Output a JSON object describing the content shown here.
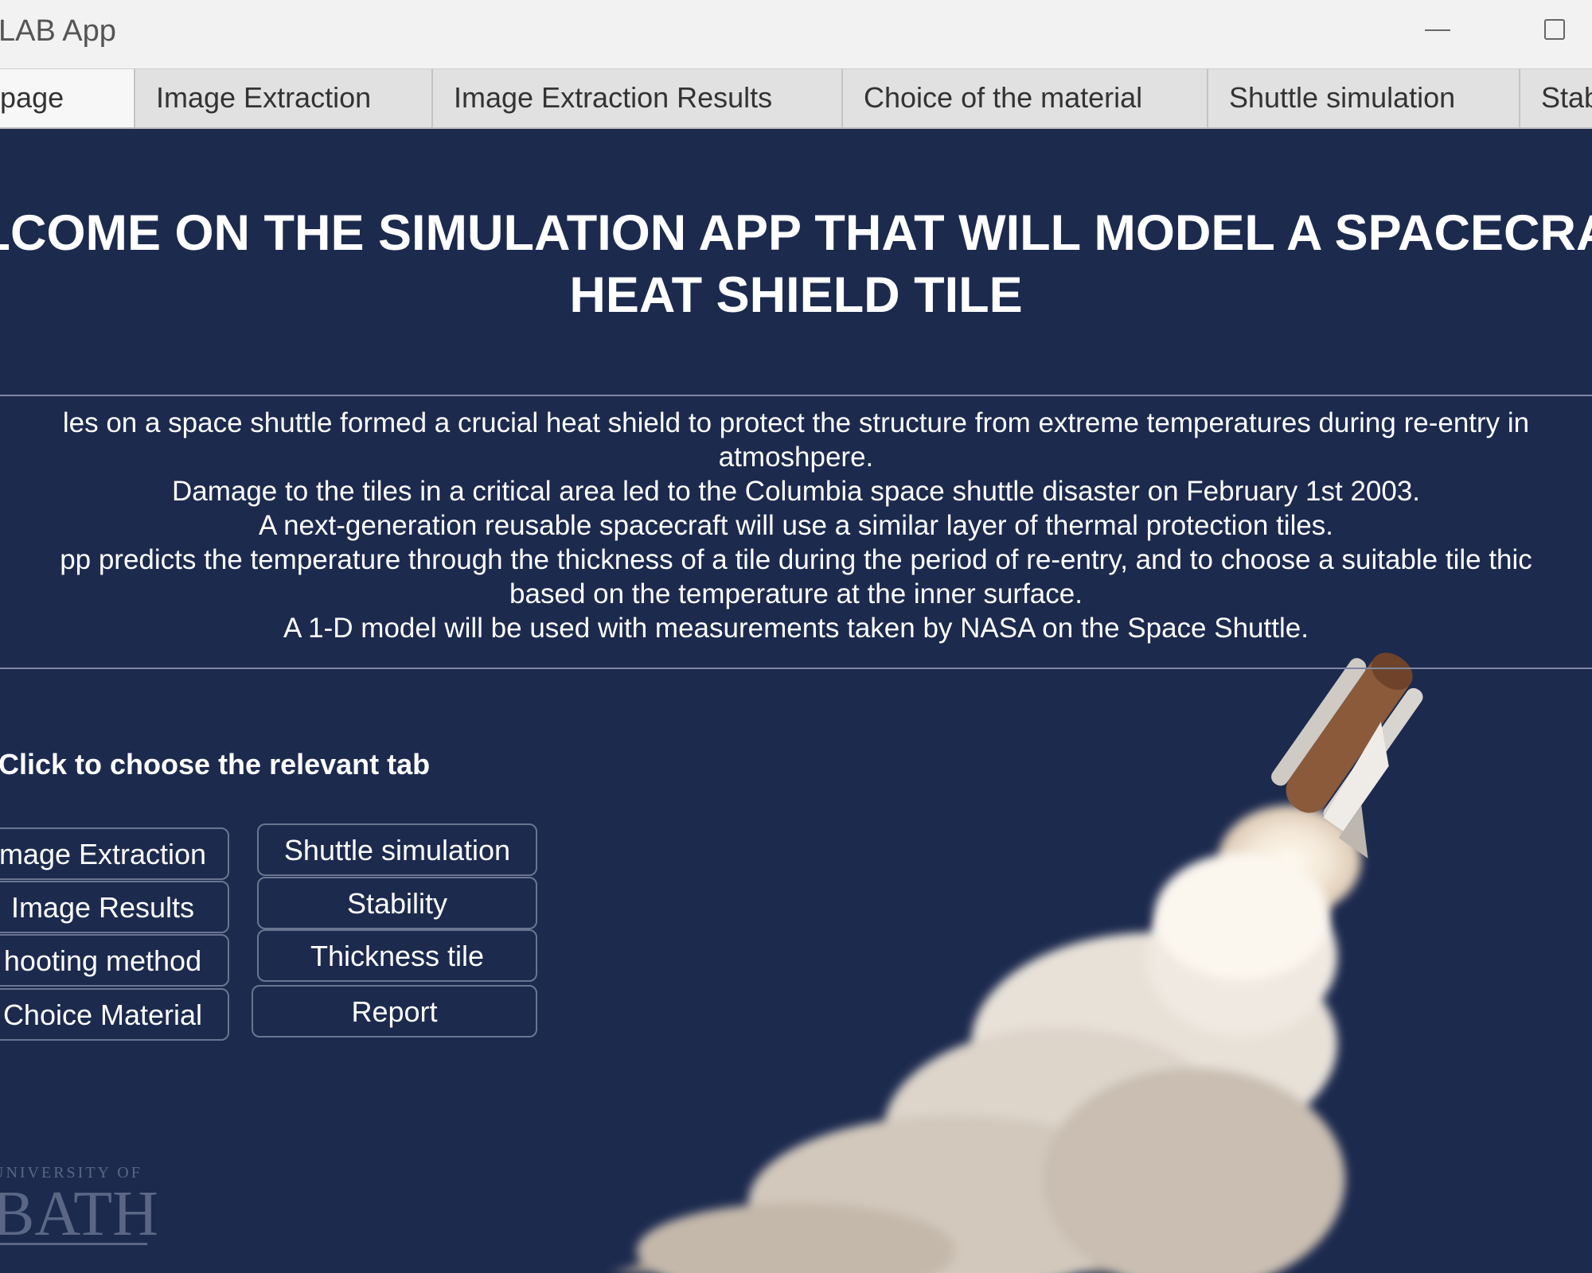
{
  "window": {
    "title": "LAB App"
  },
  "tabs": [
    {
      "label": "epage",
      "active": true
    },
    {
      "label": "Image Extraction",
      "active": false
    },
    {
      "label": "Image Extraction Results",
      "active": false
    },
    {
      "label": "Choice of the material",
      "active": false
    },
    {
      "label": "Shuttle simulation",
      "active": false
    },
    {
      "label": "Stab",
      "active": false
    }
  ],
  "main": {
    "title_line1": "LCOME ON THE SIMULATION APP THAT WILL MODEL A SPACECRA",
    "title_line2": "HEAT SHIELD TILE",
    "intro_lines": [
      "les on a space shuttle formed a crucial heat shield to protect the structure from extreme temperatures during re-entry in",
      "atmoshpere.",
      "Damage to the tiles in a critical area led to the Columbia space shuttle disaster on February 1st 2003.",
      "A next-generation reusable spacecraft will use a similar layer of thermal protection tiles.",
      "pp predicts the temperature through the thickness of a tile during the period of re-entry, and to choose a suitable tile thic",
      "based on the temperature at the inner surface.",
      "A 1-D model will be used with measurements taken by NASA on the Space Shuttle."
    ],
    "choose_label": "Click to choose the relevant tab",
    "buttons_left": [
      "mage Extraction",
      "Image Results",
      "hooting method",
      "Choice Material"
    ],
    "buttons_right": [
      "Shuttle simulation",
      "Stability",
      "Thickness tile",
      "Report"
    ]
  },
  "logo": {
    "top_text": "UNIVERSITY OF",
    "main_text": "BATH"
  },
  "colors": {
    "background": "#1c2a4e",
    "titlebar": "#f2f2f2",
    "tabstrip": "#e1e1e1",
    "text_light": "#ffffff"
  },
  "icons": {
    "minimize": "minimize-icon",
    "maximize": "maximize-icon"
  }
}
